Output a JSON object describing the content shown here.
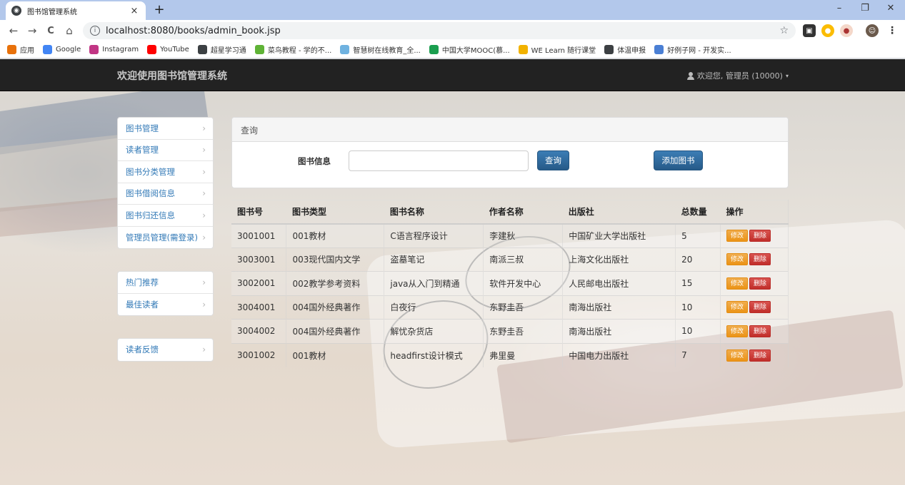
{
  "browser": {
    "tab_title": "图书馆管理系统",
    "tab_close": "×",
    "new_tab": "+",
    "url": "localhost:8080/books/admin_book.jsp",
    "window_controls": {
      "minimize": "–",
      "restore": "❐",
      "close": "✕"
    },
    "nav": {
      "back": "←",
      "forward": "→",
      "reload": "C",
      "home": "⌂",
      "star": "☆"
    },
    "bookmarks": [
      {
        "label": "应用",
        "icon": "apps-grid-icon",
        "color": "#e8710a"
      },
      {
        "label": "Google",
        "icon": "google-icon",
        "color": "#4285f4"
      },
      {
        "label": "Instagram",
        "icon": "instagram-icon",
        "color": "#c13584"
      },
      {
        "label": "YouTube",
        "icon": "youtube-icon",
        "color": "#ff0000"
      },
      {
        "label": "超星学习通",
        "icon": "globe-icon",
        "color": "#3c4043"
      },
      {
        "label": "菜鸟教程 - 学的不...",
        "icon": "runoob-icon",
        "color": "#5fb336"
      },
      {
        "label": "智慧树在线教育_全...",
        "icon": "zhihuishu-icon",
        "color": "#6fb2e0"
      },
      {
        "label": "中国大学MOOC(慕...",
        "icon": "mooc-icon",
        "color": "#1a9e4f"
      },
      {
        "label": "WE Learn 随行课堂",
        "icon": "welearn-icon",
        "color": "#f2b200"
      },
      {
        "label": "体温申报",
        "icon": "globe-icon",
        "color": "#3c4043"
      },
      {
        "label": "好例子网 - 开发实...",
        "icon": "haolizi-icon",
        "color": "#4a7fd4"
      }
    ]
  },
  "app": {
    "brand": "欢迎使用图书馆管理系统",
    "user": "欢迎您, 管理员 (10000)",
    "caret": "▾"
  },
  "sidebar": {
    "chevron": "›",
    "group1": [
      "图书管理",
      "读者管理",
      "图书分类管理",
      "图书借阅信息",
      "图书归还信息",
      "管理员管理(需登录)"
    ],
    "group2": [
      "热门推荐",
      "最佳读者"
    ],
    "group3": [
      "读者反馈"
    ]
  },
  "query": {
    "heading": "查询",
    "label": "图书信息",
    "input_value": "",
    "search_button": "查询",
    "add_button": "添加图书"
  },
  "table": {
    "headers": [
      "图书号",
      "图书类型",
      "图书名称",
      "作者名称",
      "出版社",
      "总数量",
      "操作"
    ],
    "edit_label": "修改",
    "delete_label": "删除",
    "rows": [
      [
        "3001001",
        "001教材",
        "C语言程序设计",
        "李建秋",
        "中国矿业大学出版社",
        "5"
      ],
      [
        "3003001",
        "003现代国内文学",
        "盗墓笔记",
        "南派三叔",
        "上海文化出版社",
        "20"
      ],
      [
        "3002001",
        "002教学参考资料",
        "java从入门到精通",
        "软件开发中心",
        "人民邮电出版社",
        "15"
      ],
      [
        "3004001",
        "004国外经典著作",
        "白夜行",
        "东野圭吾",
        "南海出版社",
        "10"
      ],
      [
        "3004002",
        "004国外经典著作",
        "解忧杂货店",
        "东野圭吾",
        "南海出版社",
        "10"
      ],
      [
        "3001002",
        "001教材",
        "headfirst设计模式",
        "弗里曼",
        "中国电力出版社",
        "7"
      ]
    ]
  }
}
